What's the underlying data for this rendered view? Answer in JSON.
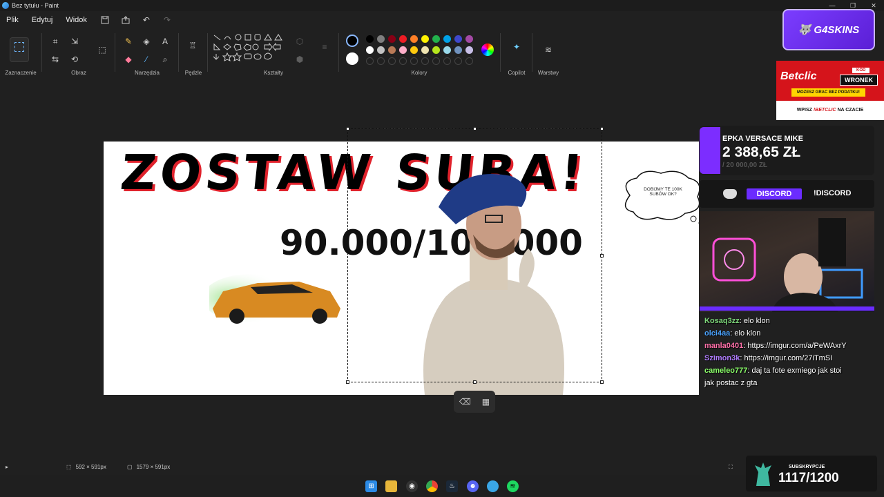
{
  "window": {
    "title": "Bez tytułu - Paint",
    "minimize": "—",
    "restore": "❐",
    "close": "✕"
  },
  "menu": {
    "items": [
      "Plik",
      "Edytuj",
      "Widok"
    ]
  },
  "ribbon": {
    "groups": {
      "selection": "Zaznaczenie",
      "image": "Obraz",
      "tools": "Narzędzia",
      "brushes": "Pędzle",
      "shapes": "Kształty",
      "colors": "Kolory",
      "copilot": "Copilot",
      "layers": "Warstwy"
    }
  },
  "canvas": {
    "headline": "ZOSTAW SUBA!",
    "subcount": "90.000/100.000",
    "bubble_text": "DOBIJMY TE 100K SUBÓW OK?"
  },
  "status": {
    "selection_size": "592 × 591px",
    "canvas_size": "1579 × 591px"
  },
  "overlay": {
    "g4skins": "G4SKINS",
    "betclic": {
      "logo": "Betclic",
      "kod_label": "KOD",
      "kod_value": "WRONEK",
      "banner": "MOZESZ GRAC BEZ PODATKU!",
      "bottom_prefix": "WPISZ",
      "bottom_code": "!BETCLIC",
      "bottom_suffix": "NA CZACIE"
    },
    "donation": {
      "title": "EPKA VERSACE MIKE",
      "amount": "2 388,65 ZŁ",
      "goal": "/ 20 000,00 ZŁ"
    },
    "discord": {
      "label": "DISCORD",
      "command": "!DISCORD"
    },
    "chat": [
      {
        "user": "Kosaq3zz",
        "color": "#7dd87a",
        "msg": ": elo klon"
      },
      {
        "user": "olci4aa",
        "color": "#4aa3ff",
        "msg": ": elo klon"
      },
      {
        "user": "manla0401",
        "color": "#ff6fa8",
        "msg": ": https://imgur.com/a/PeWAxrY"
      },
      {
        "user": "Szimon3k",
        "color": "#b07cff",
        "msg": ": https://imgur.com/27iTmSI"
      },
      {
        "user": "cameleo777",
        "color": "#8bff6a",
        "msg": ": daj ta fote exmiego jak stoi jak postac z gta"
      }
    ],
    "subs": {
      "label": "SUBSKRYPCJE",
      "value": "1117/1200"
    }
  }
}
